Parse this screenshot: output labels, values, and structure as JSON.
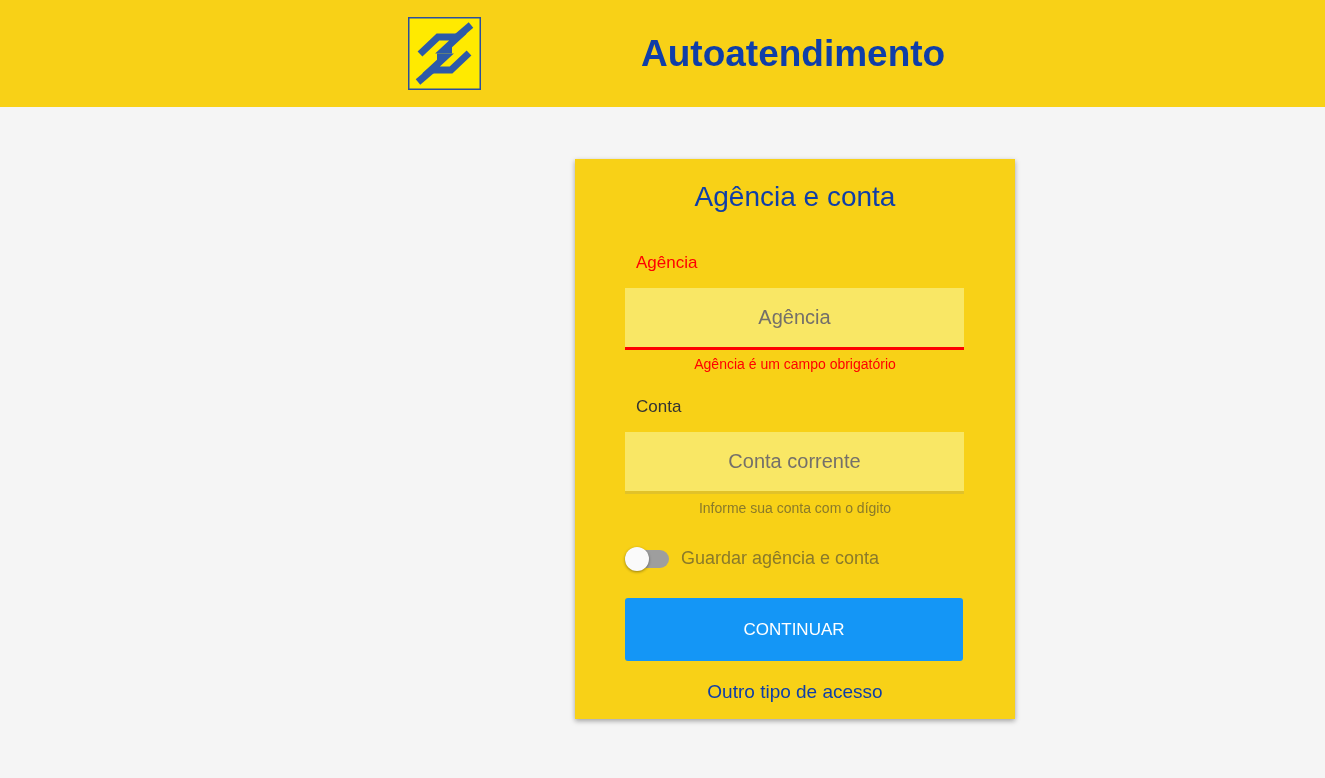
{
  "header": {
    "title": "Autoatendimento"
  },
  "card": {
    "title": "Agência e conta",
    "fields": [
      {
        "label": "Agência",
        "placeholder": "Agência",
        "message": "Agência é um campo obrigatório",
        "invalid": true
      },
      {
        "label": "Conta",
        "placeholder": "Conta corrente",
        "message": "Informe sua conta com o dígito",
        "invalid": false
      }
    ],
    "remember": {
      "label": "Guardar agência e conta",
      "on": false
    },
    "button": "CONTINUAR",
    "link": "Outro tipo de acesso"
  }
}
